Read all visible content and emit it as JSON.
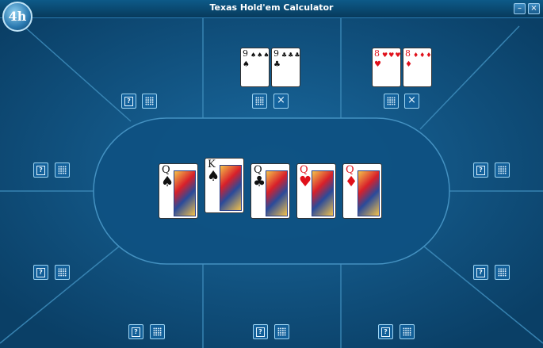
{
  "window": {
    "title": "Texas Hold'em Calculator",
    "logo_text": "4h",
    "minimize_glyph": "–",
    "close_glyph": "×"
  },
  "icons": {
    "help_glyph": "?",
    "remove_glyph": "×"
  },
  "players": [
    {
      "seat": "top-center",
      "cards": [
        {
          "rank": "9",
          "suit": "♠",
          "color": "black",
          "pips": "♠♠♠♠♠♠♠♠♠"
        },
        {
          "rank": "9",
          "suit": "♣",
          "color": "black",
          "pips": "♣♣♣♣♣♣♣♣♣"
        }
      ]
    },
    {
      "seat": "top-right",
      "cards": [
        {
          "rank": "8",
          "suit": "♥",
          "color": "red",
          "pips": "♥♥♥♥♥♥♥♥"
        },
        {
          "rank": "8",
          "suit": "♦",
          "color": "red",
          "pips": "♦♦♦♦♦♦♦♦"
        }
      ]
    }
  ],
  "board": [
    {
      "rank": "Q",
      "suit": "♠",
      "color": "black"
    },
    {
      "rank": "K",
      "suit": "♠",
      "color": "black"
    },
    {
      "rank": "Q",
      "suit": "♣",
      "color": "black"
    },
    {
      "rank": "Q",
      "suit": "♥",
      "color": "red"
    },
    {
      "rank": "Q",
      "suit": "♦",
      "color": "red"
    }
  ],
  "colors": {
    "felt": "#0b4a78",
    "line": "#3c89b8"
  }
}
